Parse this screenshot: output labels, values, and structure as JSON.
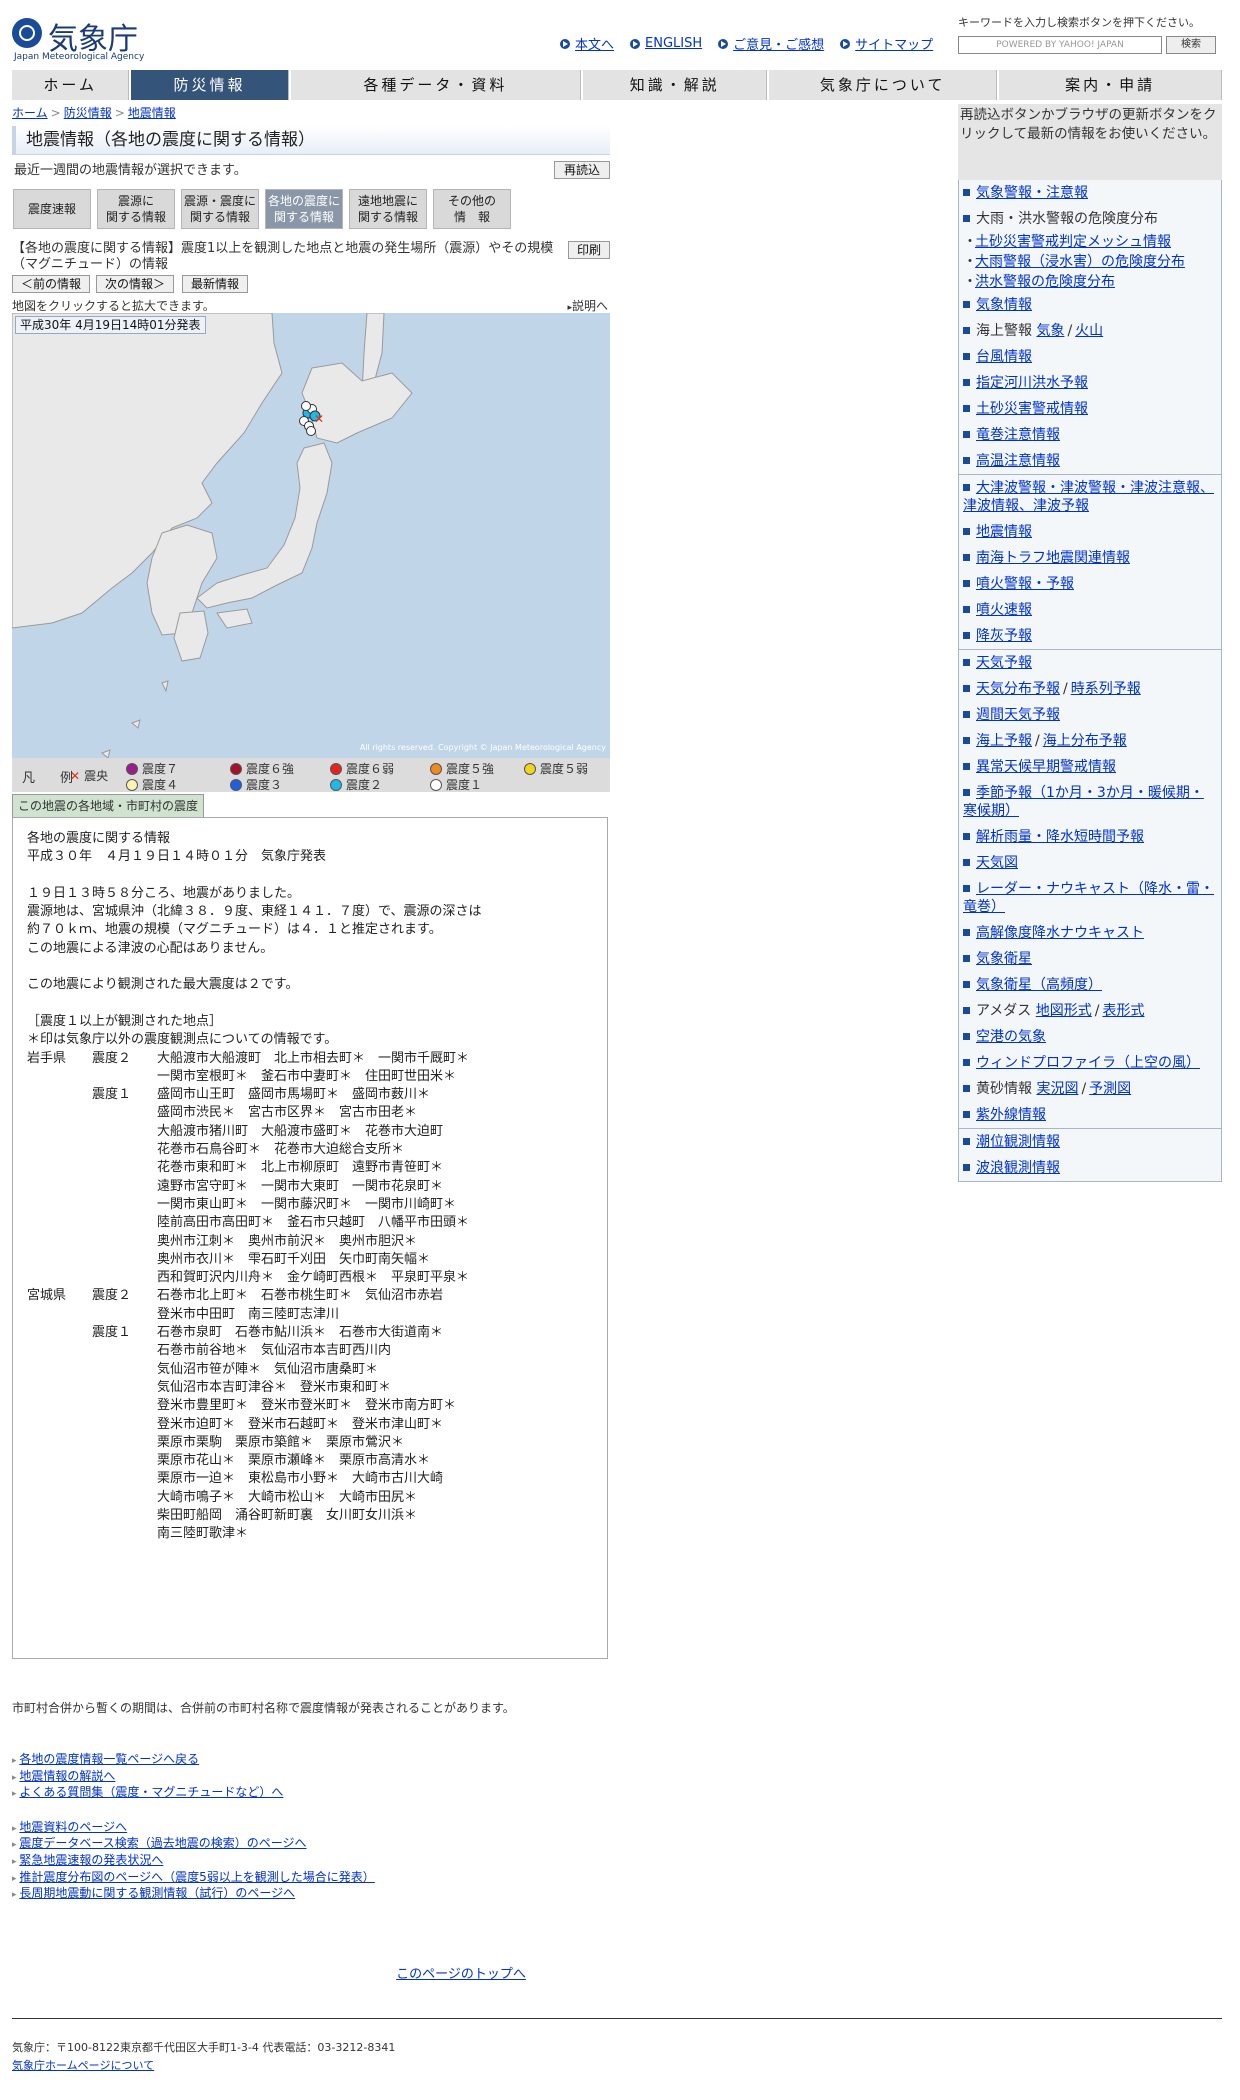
{
  "header": {
    "logo_jp": "気象庁",
    "logo_en": "Japan Meteorological Agency",
    "links": [
      "本文へ",
      "ENGLISH",
      "ご意見・ご感想",
      "サイトマップ"
    ],
    "search_hint": "キーワードを入力し検索ボタンを押下ください。",
    "search_placeholder": "POWERED BY YAHOO! JAPAN",
    "search_button": "検索"
  },
  "nav": [
    "ホーム",
    "防災情報",
    "各種データ・資料",
    "知識・解説",
    "気象庁について",
    "案内・申請"
  ],
  "breadcrumb": [
    "ホーム",
    "防災情報",
    "地震情報"
  ],
  "page_title": "地震情報（各地の震度に関する情報）",
  "subline": "最近一週間の地震情報が選択できます。",
  "reload_button": "再読込",
  "tabs": [
    "震度速報",
    "震源に\n関する情報",
    "震源・震度に\n関する情報",
    "各地の震度に\n関する情報",
    "遠地地震に\n関する情報",
    "その他の\n情　報"
  ],
  "description": "【各地の震度に関する情報】震度1以上を観測した地点と地震の発生場所（震源）やその規模（マグニチュード）の情報",
  "print_button": "印刷",
  "nav_buttons": [
    "＜前の情報",
    "次の情報＞",
    "最新情報"
  ],
  "map_hint": "地図をクリックすると拡大できます。",
  "explain_link": "説明へ",
  "map_time": "平成30年 4月19日14時01分発表",
  "map_copyright": "All rights reserved. Copyright © Japan Meteorological Agency",
  "legend": {
    "title": "凡　例",
    "epicenter": "震央",
    "items": [
      {
        "label": "震度７",
        "color": "#9b1d8c"
      },
      {
        "label": "震度６強",
        "color": "#a8102a"
      },
      {
        "label": "震度６弱",
        "color": "#e8231f"
      },
      {
        "label": "震度５強",
        "color": "#f08a1f"
      },
      {
        "label": "震度５弱",
        "color": "#f0d41f"
      },
      {
        "label": "震度４",
        "color": "#fff3b0"
      },
      {
        "label": "震度３",
        "color": "#2060e0"
      },
      {
        "label": "震度２",
        "color": "#20b8e8"
      },
      {
        "label": "震度１",
        "color": "#ffffff"
      }
    ]
  },
  "city_tab": "この地震の各地域・市町村の震度",
  "report_text": "各地の震度に関する情報\n平成３０年　４月１９日１４時０１分　気象庁発表\n\n１９日１３時５８分ころ、地震がありました。\n震源地は、宮城県沖（北緯３８．９度、東経１４１．７度）で、震源の深さは\n約７０ｋｍ、地震の規模（マグニチュード）は４．１と推定されます。\nこの地震による津波の心配はありません。\n\nこの地震により観測された最大震度は２です。\n\n［震度１以上が観測された地点］\n＊印は気象庁以外の震度観測点についての情報です。\n岩手県　　震度２　　大船渡市大船渡町　北上市相去町＊　一関市千厩町＊\n　　　　　　　　　　一関市室根町＊　釜石市中妻町＊　住田町世田米＊\n　　　　　震度１　　盛岡市山王町　盛岡市馬場町＊　盛岡市薮川＊\n　　　　　　　　　　盛岡市渋民＊　宮古市区界＊　宮古市田老＊\n　　　　　　　　　　大船渡市猪川町　大船渡市盛町＊　花巻市大迫町\n　　　　　　　　　　花巻市石鳥谷町＊　花巻市大迫総合支所＊\n　　　　　　　　　　花巻市東和町＊　北上市柳原町　遠野市青笹町＊\n　　　　　　　　　　遠野市宮守町＊　一関市大東町　一関市花泉町＊\n　　　　　　　　　　一関市東山町＊　一関市藤沢町＊　一関市川崎町＊\n　　　　　　　　　　陸前高田市高田町＊　釜石市只越町　八幡平市田頭＊\n　　　　　　　　　　奥州市江刺＊　奥州市前沢＊　奥州市胆沢＊\n　　　　　　　　　　奥州市衣川＊　雫石町千刈田　矢巾町南矢幅＊\n　　　　　　　　　　西和賀町沢内川舟＊　金ケ崎町西根＊　平泉町平泉＊\n宮城県　　震度２　　石巻市北上町＊　石巻市桃生町＊　気仙沼市赤岩\n　　　　　　　　　　登米市中田町　南三陸町志津川\n　　　　　震度１　　石巻市泉町　石巻市鮎川浜＊　石巻市大街道南＊\n　　　　　　　　　　石巻市前谷地＊　気仙沼市本吉町西川内\n　　　　　　　　　　気仙沼市笹が陣＊　気仙沼市唐桑町＊\n　　　　　　　　　　気仙沼市本吉町津谷＊　登米市東和町＊\n　　　　　　　　　　登米市豊里町＊　登米市登米町＊　登米市南方町＊\n　　　　　　　　　　登米市迫町＊　登米市石越町＊　登米市津山町＊\n　　　　　　　　　　栗原市栗駒　栗原市築館＊　栗原市鶯沢＊\n　　　　　　　　　　栗原市花山＊　栗原市瀬峰＊　栗原市高清水＊\n　　　　　　　　　　栗原市一迫＊　東松島市小野＊　大崎市古川大崎\n　　　　　　　　　　大崎市鳴子＊　大崎市松山＊　大崎市田尻＊\n　　　　　　　　　　柴田町船岡　涌谷町新町裏　女川町女川浜＊\n　　　　　　　　　　南三陸町歌津＊",
  "merge_note": "市町村合併から暫くの期間は、合併前の市町村名称で震度情報が発表されることがあります。",
  "links1": [
    "各地の震度情報一覧ページへ戻る",
    "地震情報の解説へ",
    "よくある質問集（震度・マグニチュードなど）へ"
  ],
  "links2": [
    "地震資料のページへ",
    "震度データベース検索（過去地震の検索）のページへ",
    "緊急地震速報の発表状況へ",
    "推計震度分布図のページへ（震度5弱以上を観測した場合に発表）",
    "長周期地震動に関する観測情報（試行）のページへ"
  ],
  "page_top": "このページのトップへ",
  "footer": {
    "address": "気象庁：〒100-8122東京都千代田区大手町1-3-4 代表電話：03-3212-8341",
    "about": "気象庁ホームページについて"
  },
  "side": {
    "note": "再読込ボタンかブラウザの更新ボタンをクリックして最新の情報をお使いください。",
    "g1": {
      "warning": "気象警報・注意報",
      "risk": "大雨・洪水警報の危険度分布",
      "sub1": "土砂災害警戒判定メッシュ情報",
      "sub2": "大雨警報（浸水害）の危険度分布",
      "sub3": "洪水警報の危険度分布",
      "weather_info": "気象情報",
      "marine": "海上警報",
      "marine_weather": "気象",
      "marine_volcano": "火山",
      "typhoon": "台風情報",
      "river": "指定河川洪水予報",
      "landslide": "土砂災害警戒情報",
      "tornado": "竜巻注意情報",
      "heat": "高温注意情報"
    },
    "g2": {
      "tsunami": "大津波警報・津波警報・津波注意報、津波情報、津波予報",
      "earthquake": "地震情報",
      "nankai": "南海トラフ地震関連情報",
      "eruption": "噴火警報・予報",
      "eruption_flash": "噴火速報",
      "ashfall": "降灰予報"
    },
    "g3": {
      "forecast": "天気予報",
      "dist": "天気分布予報",
      "timeseries": "時系列予報",
      "weekly": "週間天気予報",
      "sea": "海上予報",
      "sea_dist": "海上分布予報",
      "early": "異常天候早期警戒情報",
      "seasonal": "季節予報（1か月・3か月・暖候期・寒候期）",
      "analysis": "解析雨量・降水短時間予報",
      "chart": "天気図",
      "radar": "レーダー・ナウキャスト（降水・雷・竜巻）",
      "hires": "高解像度降水ナウキャスト",
      "satellite": "気象衛星",
      "satellite_hf": "気象衛星（高頻度）",
      "amedas": "アメダス",
      "amedas_map": "地図形式",
      "amedas_table": "表形式",
      "airport": "空港の気象",
      "profiler": "ウィンドプロファイラ（上空の風）",
      "yellow_sand": "黄砂情報",
      "ys_real": "実況図",
      "ys_fore": "予測図",
      "uv": "紫外線情報"
    },
    "g4": {
      "tide": "潮位観測情報",
      "wave": "波浪観測情報"
    }
  }
}
